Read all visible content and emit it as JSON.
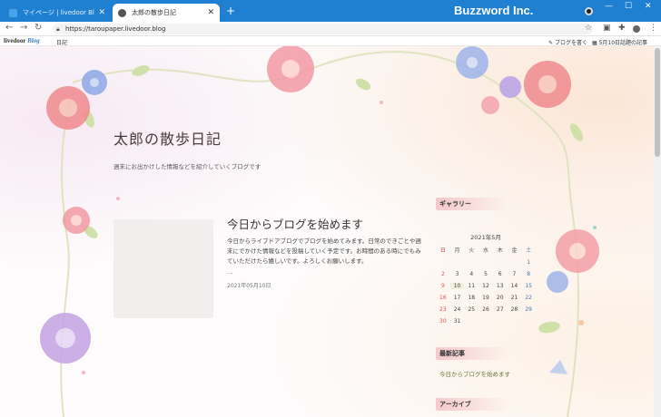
{
  "browser": {
    "tabs": [
      {
        "label": "マイページ | livedoor Blog",
        "active": false
      },
      {
        "label": "太郎の散歩日記",
        "active": true
      }
    ],
    "url": "https://taroupaper.livedoor.blog",
    "brand": "Buzzword Inc."
  },
  "livedoor_bar": {
    "logo_main": "livedoor",
    "logo_blog": "Blog",
    "nav_label": "日記",
    "write_label": "ブログを書く",
    "topic_label": "5月10日話題の記事"
  },
  "blog": {
    "title": "太郎の散歩日記",
    "description": "週末にお出かけした情報などを紹介していくブログです"
  },
  "post": {
    "title": "今日からブログを始めます",
    "excerpt": "今日からライブドアブログでブログを始めてみます。日常のできごとや週末にでかけた情報などを投稿していく予定です。お時間のある時にでもみていただけたら嬉しいです。よろしくお願いします。",
    "more": "…",
    "date": "2021年05月10日"
  },
  "sidebar": {
    "gallery_heading": "ギャラリー",
    "calendar_title": "2021年5月",
    "weekdays": [
      "日",
      "月",
      "火",
      "水",
      "木",
      "金",
      "土"
    ],
    "days": [
      "",
      "",
      "",
      "",
      "",
      "",
      "1",
      "2",
      "3",
      "4",
      "5",
      "6",
      "7",
      "8",
      "9",
      "10",
      "11",
      "12",
      "13",
      "14",
      "15",
      "16",
      "17",
      "18",
      "19",
      "20",
      "21",
      "22",
      "23",
      "24",
      "25",
      "26",
      "27",
      "28",
      "29",
      "30",
      "31",
      "",
      "",
      "",
      "",
      ""
    ],
    "today": "10",
    "recent_heading": "最新記事",
    "recent_items": [
      "今日からブログを始めます"
    ],
    "archive_heading": "アーカイブ"
  },
  "colors": {
    "chrome_blue": "#1f7fd1",
    "link_green": "#6a7a3a",
    "heading_pink": "#eeaab4"
  }
}
